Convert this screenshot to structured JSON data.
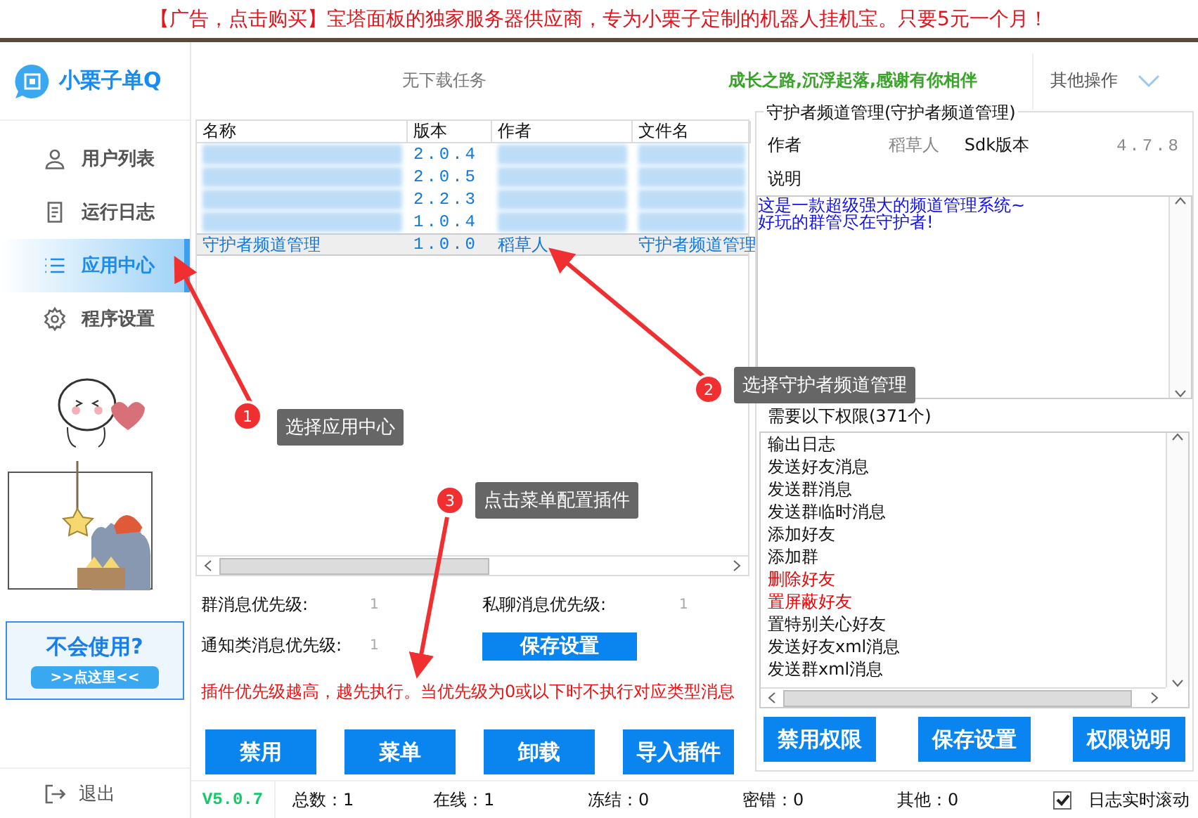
{
  "ad_banner": {
    "text": "【广告，点击购买】宝塔面板的独家服务器供应商，专为小栗子定制的机器人挂机宝。只要5元一个月！"
  },
  "sidebar": {
    "logo_text": "小栗子单Q",
    "nav": [
      {
        "label": "用户列表",
        "selected": false
      },
      {
        "label": "运行日志",
        "selected": false
      },
      {
        "label": "应用中心",
        "selected": true
      },
      {
        "label": "程序设置",
        "selected": false
      }
    ],
    "help_card": {
      "title": "不会使用?",
      "button": ">>点这里<<"
    },
    "logout": "退出"
  },
  "header": {
    "download_status": "无下载任务",
    "motto": "成长之路,沉浮起落,感谢有你相伴",
    "menu_label": "其他操作"
  },
  "plugin_table": {
    "columns": [
      "名称",
      "版本",
      "作者",
      "文件名"
    ],
    "rows": [
      {
        "version": "2.0.4",
        "redacted": true,
        "selected": false
      },
      {
        "version": "2.0.5",
        "redacted": true,
        "selected": false
      },
      {
        "version": "2.2.3",
        "redacted": true,
        "selected": false
      },
      {
        "version": "1.0.4",
        "redacted": true,
        "selected": false
      },
      {
        "name": "守护者频道管理",
        "version": "1.0.0",
        "author": "稻草人",
        "filename": "守护者频道管理",
        "redacted": false,
        "selected": true
      }
    ]
  },
  "priority": {
    "fields": [
      {
        "label": "群消息优先级:",
        "value": "1"
      },
      {
        "label": "私聊消息优先级:",
        "value": "1"
      },
      {
        "label": "通知类消息优先级:",
        "value": "1"
      }
    ],
    "save_button": "保存设置",
    "note": "插件优先级越高，越先执行。当优先级为0或以下时不执行对应类型消息"
  },
  "action_buttons": [
    "禁用",
    "菜单",
    "卸载",
    "导入插件"
  ],
  "plugin_detail": {
    "title": "守护者频道管理(守护者频道管理)",
    "author_label": "作者",
    "author": "稻草人",
    "sdk_label": "Sdk版本",
    "sdk_version": "4.7.8",
    "description_label": "说明",
    "description": [
      "这是一款超级强大的频道管理系统~",
      "好玩的群管尽在守护者!"
    ],
    "permissions_title": "需要以下权限(371个)",
    "permissions": [
      {
        "label": "输出日志",
        "dangerous": false
      },
      {
        "label": "发送好友消息",
        "dangerous": false
      },
      {
        "label": "发送群消息",
        "dangerous": false
      },
      {
        "label": "发送群临时消息",
        "dangerous": false
      },
      {
        "label": "添加好友",
        "dangerous": false
      },
      {
        "label": "添加群",
        "dangerous": false
      },
      {
        "label": "删除好友",
        "dangerous": true
      },
      {
        "label": "置屏蔽好友",
        "dangerous": true
      },
      {
        "label": "置特别关心好友",
        "dangerous": false
      },
      {
        "label": "发送好友xml消息",
        "dangerous": false
      },
      {
        "label": "发送群xml消息",
        "dangerous": false
      }
    ],
    "buttons": [
      "禁用权限",
      "保存设置",
      "权限说明"
    ]
  },
  "status_bar": {
    "version": "V5.0.7",
    "stats": [
      "总数：1",
      "在线：1",
      "冻结：0",
      "密错：0",
      "其他：0"
    ],
    "auto_scroll": {
      "label": "日志实时滚动",
      "checked": true
    }
  },
  "annotations": [
    {
      "number": "1",
      "text": "选择应用中心"
    },
    {
      "number": "2",
      "text": "选择守护者频道管理"
    },
    {
      "number": "3",
      "text": "点击菜单配置插件"
    }
  ]
}
